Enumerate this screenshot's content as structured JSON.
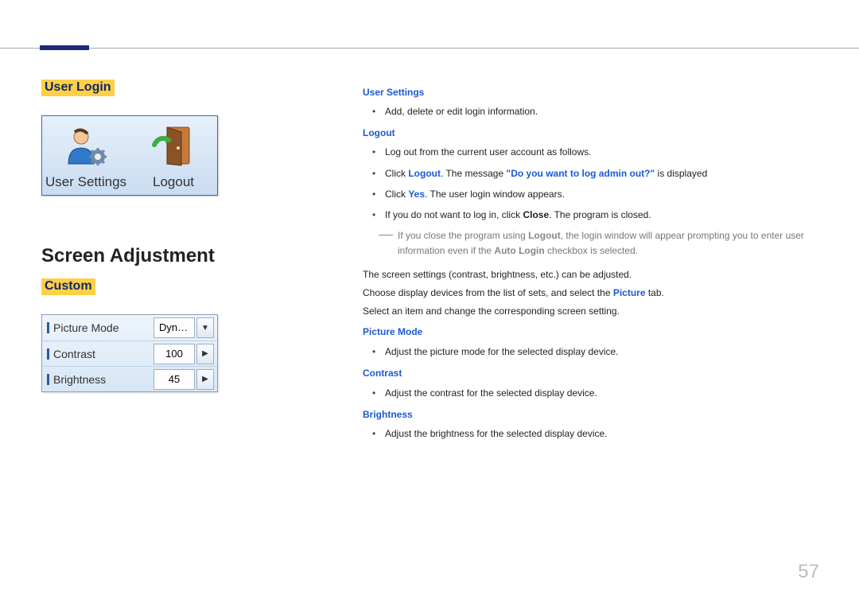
{
  "page_number": "57",
  "left": {
    "heading_user_login": "User Login",
    "tile_user_settings": "User Settings",
    "tile_logout": "Logout",
    "heading_screen_adjustment": "Screen Adjustment",
    "heading_custom": "Custom",
    "rows": [
      {
        "label": "Picture Mode",
        "value": "Dyn…",
        "style": "dropdown"
      },
      {
        "label": "Contrast",
        "value": "100",
        "style": "spinner"
      },
      {
        "label": "Brightness",
        "value": "45",
        "style": "spinner"
      }
    ]
  },
  "right_section1": {
    "h_user_settings": "User Settings",
    "li_us_1": "Add, delete or edit login information.",
    "h_logout": "Logout",
    "li_lo_1": "Log out from the current user account as follows.",
    "li_lo_2a": "Click ",
    "li_lo_2b": "Logout",
    "li_lo_2c": ". The message ",
    "li_lo_2d": "\"Do you want to log admin out?\"",
    "li_lo_2e": " is displayed",
    "li_lo_3a": "Click ",
    "li_lo_3b": "Yes",
    "li_lo_3c": ". The user login window appears.",
    "li_lo_4a": "If you do not want to log in, click ",
    "li_lo_4b": "Close",
    "li_lo_4c": ". The program is closed.",
    "note_a": "If you close the program using ",
    "note_b": "Logout",
    "note_c": ", the login window will appear prompting you to enter user information even if the ",
    "note_d": "Auto Login",
    "note_e": " checkbox is selected."
  },
  "right_section2": {
    "p1": "The screen settings (contrast, brightness, etc.) can be adjusted.",
    "p2a": "Choose display devices from the list of sets, and select the ",
    "p2b": "Picture",
    "p2c": " tab.",
    "p3": "Select an item and change the corresponding screen setting.",
    "h_pm": "Picture Mode",
    "li_pm": "Adjust the picture mode for the selected display device.",
    "h_ct": "Contrast",
    "li_ct": "Adjust the contrast for the selected display device.",
    "h_br": "Brightness",
    "li_br": "Adjust the brightness for the selected display device."
  }
}
